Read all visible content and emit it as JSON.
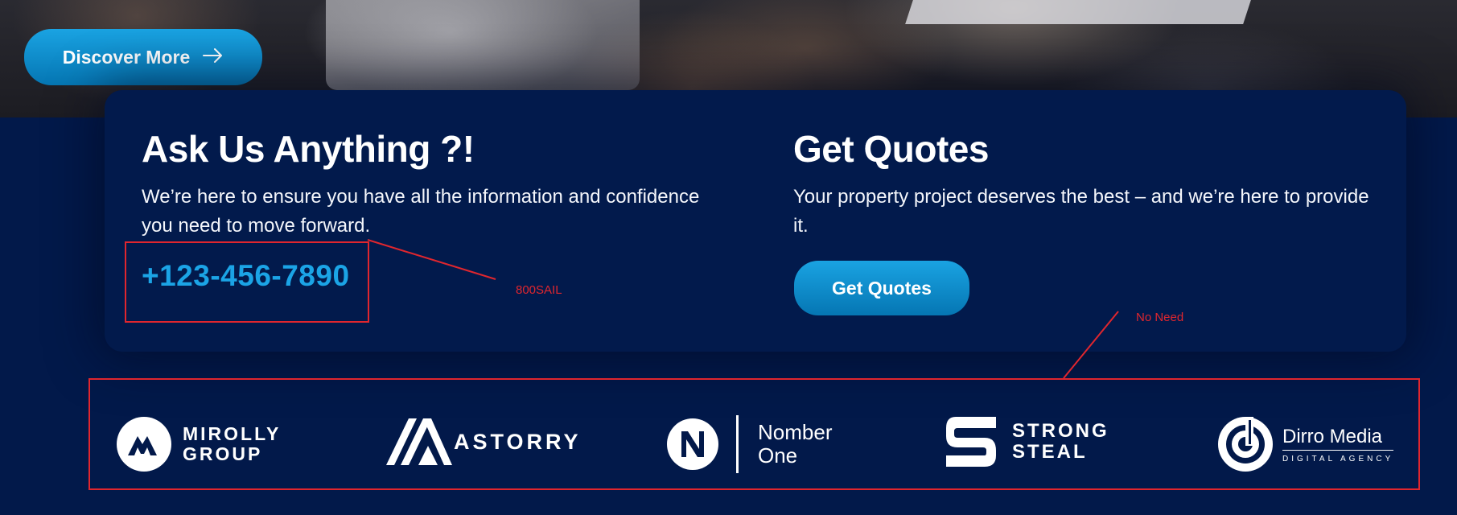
{
  "hero": {
    "discover_label": "Discover More",
    "arrow_icon": "arrow-right-icon"
  },
  "ask": {
    "title": "Ask Us Anything ?!",
    "description": "We’re here to ensure you have all the information and confidence you need to move forward.",
    "phone": "+123-456-7890"
  },
  "quotes": {
    "title": "Get Quotes",
    "description": "Your property project deserves the best – and we’re here to provide it.",
    "button_label": "Get Quotes"
  },
  "annotations": {
    "phone_note": "800SAIL",
    "logos_note": "No Need",
    "color": "#e0262e"
  },
  "logos": {
    "mirolly": {
      "line1": "MIROLLY",
      "line2": "GROUP"
    },
    "astorry": {
      "name": "ASTORRY"
    },
    "nomber": {
      "line1": "Nomber",
      "line2": "One"
    },
    "strong": {
      "line1": "STRONG",
      "line2": "STEAL"
    },
    "dirro": {
      "name": "Dirro Media",
      "tagline": "DIGITAL AGENCY"
    }
  },
  "colors": {
    "background": "#02194a",
    "accent": "#1ba4e6",
    "button": "#0a8ccc"
  }
}
